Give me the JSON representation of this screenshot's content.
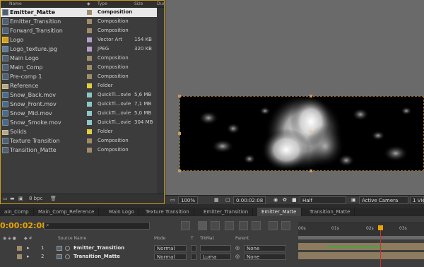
{
  "project": {
    "headers": {
      "name": "Name",
      "type": "Type",
      "size": "Size",
      "duration": "Dur"
    },
    "items": [
      {
        "name": "Emitter_Matte",
        "type": "Composition",
        "size": "",
        "icon": "composition-icon",
        "label_color": "#a08c6a",
        "selected": true
      },
      {
        "name": "Emitter_Transition",
        "type": "Composition",
        "size": "",
        "icon": "composition-icon",
        "label_color": "#a08c6a"
      },
      {
        "name": "Forward_Transition",
        "type": "Composition",
        "size": "",
        "icon": "composition-icon",
        "label_color": "#a08c6a"
      },
      {
        "name": "Logo",
        "type": "Vector Art",
        "size": "154 KB",
        "icon": "vector-art-icon",
        "label_color": "#b4a0c8"
      },
      {
        "name": "Logo_texture.jpg",
        "type": "JPEG",
        "size": "320 KB",
        "icon": "image-icon",
        "label_color": "#b4a0c8"
      },
      {
        "name": "Main Logo",
        "type": "Composition",
        "size": "",
        "icon": "composition-icon",
        "label_color": "#a08c6a"
      },
      {
        "name": "Main_Comp",
        "type": "Composition",
        "size": "",
        "icon": "composition-icon",
        "label_color": "#a08c6a"
      },
      {
        "name": "Pre-comp 1",
        "type": "Composition",
        "size": "",
        "icon": "composition-icon",
        "label_color": "#a08c6a"
      },
      {
        "name": "Reference",
        "type": "Folder",
        "size": "",
        "icon": "folder-icon",
        "label_color": "#e0d040"
      },
      {
        "name": "Snow_Back.mov",
        "type": "QuickTi...ovie",
        "size": "5,6 MB",
        "icon": "movie-icon",
        "label_color": "#8cc8c8"
      },
      {
        "name": "Snow_Front.mov",
        "type": "QuickTi...ovie",
        "size": "7,1 MB",
        "icon": "movie-icon",
        "label_color": "#8cc8c8"
      },
      {
        "name": "Snow_Mid.mov",
        "type": "QuickTi...ovie",
        "size": "5,0 MB",
        "icon": "movie-icon",
        "label_color": "#8cc8c8"
      },
      {
        "name": "Snow_Smoke.mov",
        "type": "QuickTi...ovie",
        "size": "304 MB",
        "icon": "movie-icon",
        "label_color": "#8cc8c8"
      },
      {
        "name": "Solids",
        "type": "Folder",
        "size": "",
        "icon": "folder-icon",
        "label_color": "#e0d040"
      },
      {
        "name": "Texture Transition",
        "type": "Composition",
        "size": "",
        "icon": "composition-icon",
        "label_color": "#a08c6a"
      },
      {
        "name": "Transition_Matte",
        "type": "Composition",
        "size": "",
        "icon": "composition-icon",
        "label_color": "#a08c6a"
      }
    ],
    "footer": {
      "bpc": "8 bpc"
    }
  },
  "viewer": {
    "zoom": "100%",
    "timecode": "0:00:02:08",
    "resolution": "Half",
    "camera": "Active Camera",
    "views": "1 Vie"
  },
  "tabs": [
    {
      "label": "ain_Comp",
      "active": false
    },
    {
      "label": "Main_Comp_Reference",
      "active": false
    },
    {
      "label": "Main Logo",
      "active": false
    },
    {
      "label": "Texture Transition",
      "active": false
    },
    {
      "label": "Emitter_Transition",
      "active": false
    },
    {
      "label": "Emitter_Matte",
      "active": true
    },
    {
      "label": "Transition_Matte",
      "active": false
    }
  ],
  "timeline": {
    "current_time": "0:00:02:08",
    "headers": {
      "source_name": "Source Name",
      "mode": "Mode",
      "t": "T",
      "trkmat": "TrkMat",
      "parent": "Parent"
    },
    "ruler": [
      "00s",
      "01s",
      "02s",
      "03s"
    ],
    "layers": [
      {
        "num": "1",
        "name": "Emitter_Transition",
        "mode": "Normal",
        "trkmat": "",
        "parent": "None"
      },
      {
        "num": "2",
        "name": "Transition_Matte",
        "mode": "Normal",
        "trkmat": "Luma",
        "parent": "None"
      }
    ]
  },
  "colors": {
    "accent": "#e8a400",
    "panel_border": "#c89b1c",
    "cti": "#d03030"
  }
}
